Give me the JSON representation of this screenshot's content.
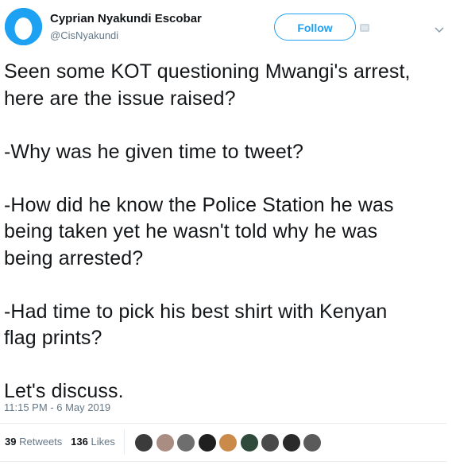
{
  "profile": {
    "name": "Cyprian Nyakundi Escobar",
    "handle": "@CisNyakundi",
    "avatar_icon": "default-egg-icon",
    "accent_color": "#1da1f2"
  },
  "header": {
    "follow_label": "Follow",
    "menu_icon": "chevron-down-icon"
  },
  "tweet": {
    "paragraphs": [
      [
        "Seen some KOT questioning Mwangi's arrest,",
        "here are the issue raised?"
      ],
      [
        "-Why was he given time to tweet?"
      ],
      [
        "-How did he know the Police Station he was",
        "being taken yet he wasn't told why he was",
        "being arrested?"
      ],
      [
        "-Had time to pick his best shirt with Kenyan",
        "flag prints?"
      ],
      [
        "Let's discuss."
      ]
    ],
    "timestamp": "11:15 PM - 6 May 2019"
  },
  "stats": {
    "retweets_count": "39",
    "retweets_label": "Retweets",
    "likes_count": "136",
    "likes_label": "Likes"
  },
  "liked_by": [
    {
      "name": "liker-avatar-1",
      "color": "#3b3b3b"
    },
    {
      "name": "liker-avatar-2",
      "color": "#a98c82"
    },
    {
      "name": "liker-avatar-3",
      "color": "#6e6e6e"
    },
    {
      "name": "liker-avatar-4",
      "color": "#1f1f1f"
    },
    {
      "name": "liker-avatar-5",
      "color": "#c98a4a"
    },
    {
      "name": "liker-avatar-6",
      "color": "#2f4a3a"
    },
    {
      "name": "liker-avatar-7",
      "color": "#4a4a4a"
    },
    {
      "name": "liker-avatar-8",
      "color": "#2a2a2a"
    },
    {
      "name": "liker-avatar-9",
      "color": "#5a5a5a"
    }
  ]
}
